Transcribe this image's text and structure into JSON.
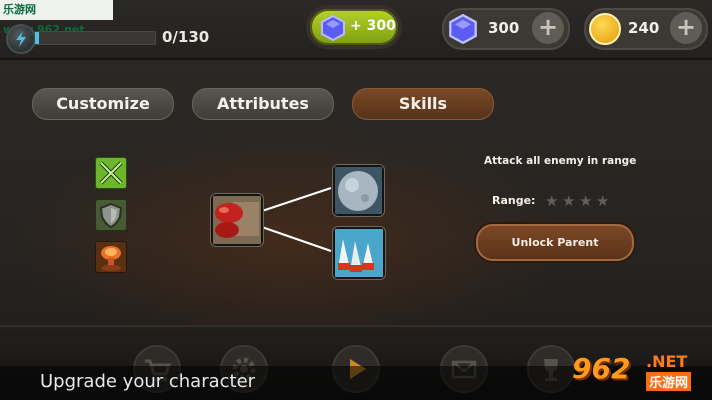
{
  "watermark": {
    "top_text": "乐游网 www.962.net",
    "logo_number": "962",
    "logo_net": ".NET",
    "logo_cn": "乐游网"
  },
  "xp": {
    "text": "0/130",
    "progress": 0.03
  },
  "gem_bonus": {
    "text": "+ 300"
  },
  "gems": {
    "value": "300",
    "plus_label": "+"
  },
  "coins": {
    "value": "240",
    "plus_label": "+"
  },
  "tabs": [
    {
      "label": "Customize",
      "selected": false
    },
    {
      "label": "Attributes",
      "selected": false
    },
    {
      "label": "Skills",
      "selected": true
    }
  ],
  "skill_categories": [
    {
      "icon": "crossed-swords-icon"
    },
    {
      "icon": "shield-icon"
    },
    {
      "icon": "explosion-icon"
    }
  ],
  "skill_tree": [
    {
      "icon": "boxing-glove-icon"
    },
    {
      "icon": "stone-sphere-icon"
    },
    {
      "icon": "ice-spikes-icon"
    }
  ],
  "details": {
    "description": "Attack all enemy in range",
    "range_label": "Range:",
    "range_stars_filled": 0,
    "range_stars_total": 4,
    "unlock_label": "Unlock Parent"
  },
  "bottom_nav": [
    {
      "icon": "cart-icon"
    },
    {
      "icon": "gear-icon"
    },
    {
      "icon": "play-icon"
    },
    {
      "icon": "mail-icon"
    },
    {
      "icon": "trophy-icon"
    }
  ],
  "caption": "Upgrade your character",
  "colors": {
    "accent_green": "#9dbf1e",
    "tab_selected": "#6d3f20",
    "xp_blue": "#4ac1e3",
    "coin": "#f2b21e",
    "gem": "#5a5cf0"
  }
}
